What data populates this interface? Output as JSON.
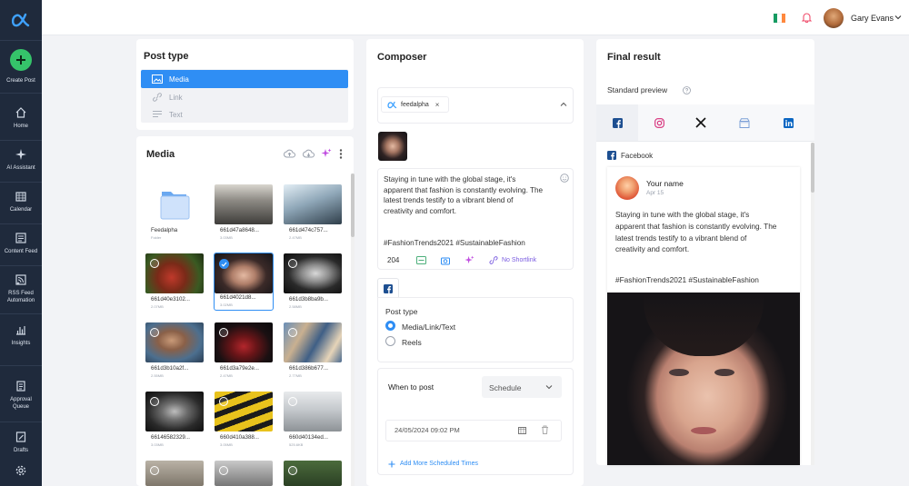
{
  "sidebar": {
    "create_label": "Create Post",
    "items": [
      {
        "label": "Home",
        "icon": "home-icon"
      },
      {
        "label": "AI Assistant",
        "icon": "sparkle-icon"
      },
      {
        "label": "Calendar",
        "icon": "calendar-icon"
      },
      {
        "label": "Content Feed",
        "icon": "feed-icon"
      },
      {
        "label": "RSS Feed",
        "label2": "Automation",
        "icon": "rss-icon"
      },
      {
        "label": "Insights",
        "icon": "chart-icon"
      },
      {
        "label": "Approval",
        "label2": "Queue",
        "icon": "approval-icon"
      },
      {
        "label": "Drafts",
        "icon": "drafts-icon"
      }
    ],
    "settings_icon": "gear-icon"
  },
  "topbar": {
    "user_name": "Gary Evans",
    "flag_colors": [
      "#169b62",
      "#ffffff",
      "#ff883e"
    ],
    "bell_color": "#f0506e"
  },
  "post_type": {
    "title": "Post type",
    "options": [
      "Media",
      "Link",
      "Text"
    ],
    "selected": "Media"
  },
  "media": {
    "title": "Media",
    "items": [
      {
        "name": "Feedalpha",
        "size": "Folder",
        "kind": "folder"
      },
      {
        "name": "661d47a8648...",
        "size": "3.03MB",
        "kind": "photo"
      },
      {
        "name": "661d474c757...",
        "size": "2.47MB",
        "kind": "photo"
      },
      {
        "name": "661d40e3102...",
        "size": "2.07MB",
        "kind": "photo"
      },
      {
        "name": "661d4021d8...",
        "size": "3.02MB",
        "kind": "photo",
        "selected": true
      },
      {
        "name": "661d3b8ba9b...",
        "size": "2.58MB",
        "kind": "photo"
      },
      {
        "name": "661d3b10a2f...",
        "size": "2.55MB",
        "kind": "photo"
      },
      {
        "name": "661d3a79e2e...",
        "size": "2.47MB",
        "kind": "photo"
      },
      {
        "name": "661d386b677...",
        "size": "2.77MB",
        "kind": "photo"
      },
      {
        "name": "66146582329...",
        "size": "3.03MB",
        "kind": "photo"
      },
      {
        "name": "660d410a388...",
        "size": "3.05MB",
        "kind": "photo"
      },
      {
        "name": "660d40134ed...",
        "size": "525.6KB",
        "kind": "photo"
      }
    ]
  },
  "composer": {
    "title": "Composer",
    "account_tag": "feedalpha",
    "post_text": [
      "Staying in tune with the global stage, it's",
      "apparent that fashion is constantly evolving. The",
      "latest trends testify to a vibrant blend of",
      "creativity and comfort."
    ],
    "hashtags": "#FashionTrends2021 #SustainableFashion",
    "char_count": "204",
    "shortlink_label": "No Shortlink",
    "post_type_label": "Post type",
    "post_type_options": [
      "Media/Link/Text",
      "Reels"
    ],
    "post_type_selected": "Media/Link/Text",
    "when_label": "When to post",
    "schedule_value": "Schedule",
    "datetime": "24/05/2024 09:02 PM",
    "add_times_label": "Add More Scheduled Times"
  },
  "final": {
    "title": "Final result",
    "preview_label": "Standard preview",
    "tabs": [
      "facebook-icon",
      "instagram-icon",
      "x-icon",
      "gbp-icon",
      "linkedin-icon"
    ],
    "network_label": "Facebook",
    "author": "Your name",
    "date": "Apr 15",
    "post_text": [
      "Staying in tune with the global stage, it's",
      "apparent that fashion is constantly evolving. The",
      "latest trends testify to a vibrant blend of",
      "creativity and comfort."
    ],
    "hashtags": "#FashionTrends2021 #SustainableFashion"
  },
  "colors": {
    "accent": "#2f8ef4",
    "sidebar": "#1f2a3c",
    "create": "#35c46a",
    "ai": "#c04de0"
  }
}
